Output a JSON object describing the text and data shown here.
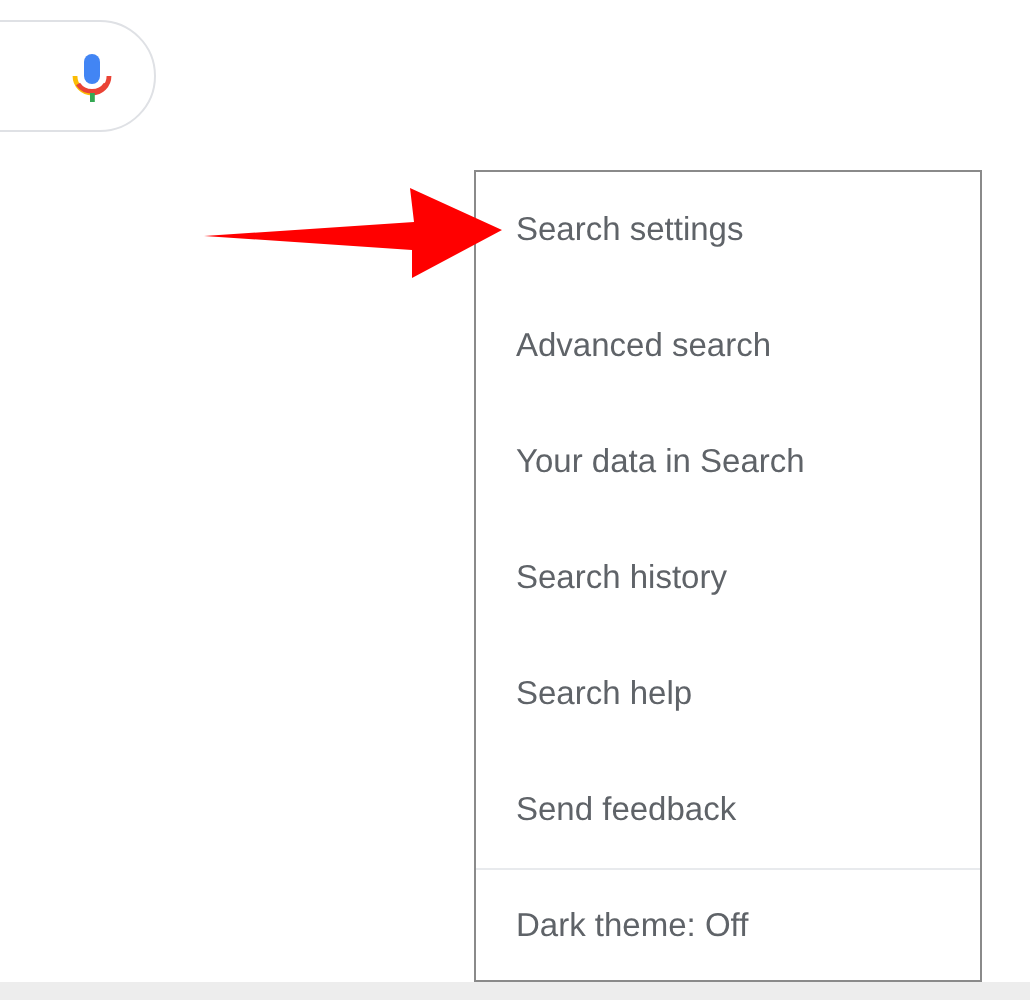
{
  "search_box": {
    "has_voice_button": true
  },
  "menu": {
    "items": [
      "Search settings",
      "Advanced search",
      "Your data in Search",
      "Search history",
      "Search help",
      "Send feedback"
    ],
    "footer_item": "Dark theme: Off"
  },
  "annotation_arrow": true
}
